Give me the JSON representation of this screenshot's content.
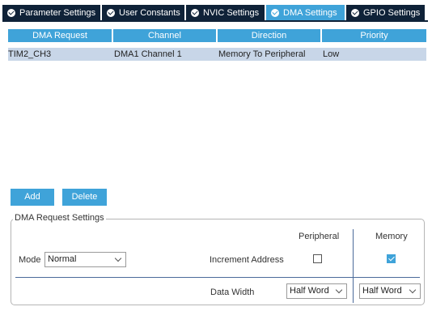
{
  "tabs": [
    {
      "label": "Parameter Settings",
      "active": false
    },
    {
      "label": "User Constants",
      "active": false
    },
    {
      "label": "NVIC Settings",
      "active": false
    },
    {
      "label": "DMA Settings",
      "active": true
    },
    {
      "label": "GPIO Settings",
      "active": false
    }
  ],
  "table": {
    "headers": [
      "DMA Request",
      "Channel",
      "Direction",
      "Priority"
    ],
    "rows": [
      {
        "request": "TIM2_CH3",
        "channel": "DMA1 Channel 1",
        "direction": "Memory To Peripheral",
        "priority": "Low"
      }
    ]
  },
  "buttons": {
    "add": "Add",
    "delete": "Delete"
  },
  "request_settings": {
    "title": "DMA Request Settings",
    "mode_label": "Mode",
    "mode_value": "Normal",
    "peripheral_header": "Peripheral",
    "memory_header": "Memory",
    "increment_label": "Increment Address",
    "increment_peripheral": false,
    "increment_memory": true,
    "data_width_label": "Data Width",
    "data_width_peripheral": "Half Word",
    "data_width_memory": "Half Word"
  },
  "colors": {
    "accent": "#3fa3d9",
    "tab_dark": "#0f2238",
    "row_selected": "#c8d6e8"
  }
}
